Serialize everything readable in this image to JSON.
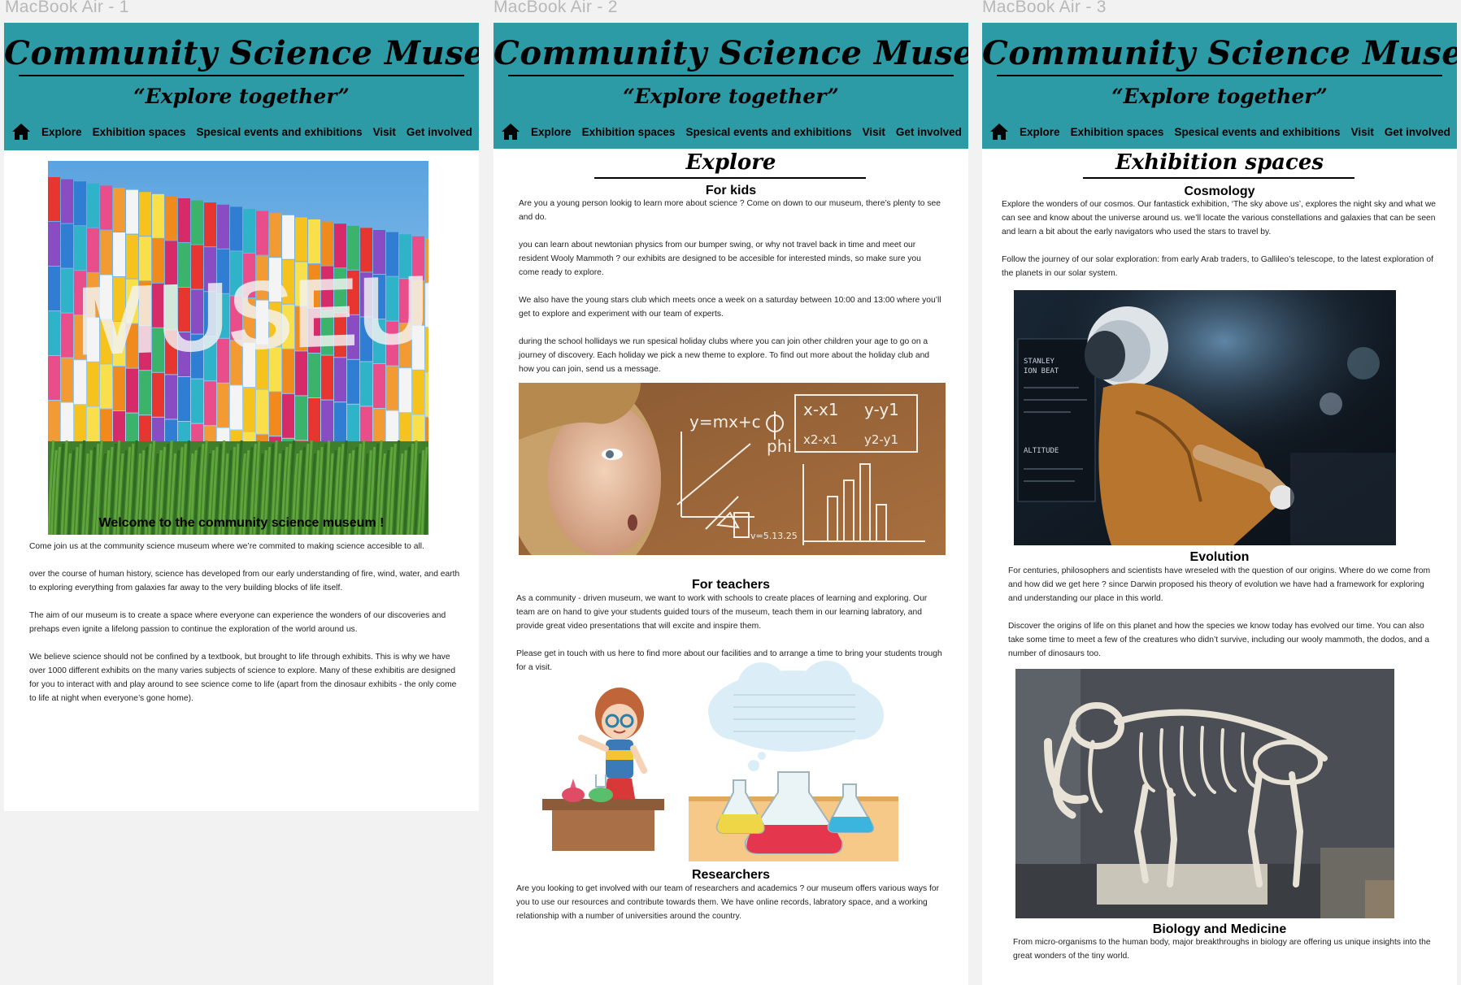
{
  "frames": [
    {
      "label": "MacBook Air - 1",
      "welcome_heading": "Welcome to the community science museum !",
      "paragraphs": [
        "Come join us at the community science museum where we’re commited to making science accesible to all.",
        "over the course of human history, science has developed from our early understanding of fire, wind, water, and earth to exploring everything from galaxies far away to the very building blocks of life itself.",
        "The aim of our museum is to create a space where everyone can experience the wonders of our discoveries and prehaps even ignite a lifelong passion to continue the exploration of the world around us.",
        "We believe science should not be confined by a textbook, but brought to life through exhibits. This is why we have over 1000 different exhibits on the many varies subjects of science to explore. Many of these exhibitis are designed for you to interact with and play around to see science come to life (apart from the dinosaur exhibits - the only come to life at night when everyone’s gone home)."
      ]
    },
    {
      "label": "MacBook Air - 2",
      "section_heading": "Explore",
      "kids_heading": "For kids",
      "kids_paragraphs": [
        "Are you a young person lookig to learn more about science ? Come on down to our museum, there’s plenty to see and do.",
        "you can learn about newtonian physics from our bumper swing, or why not travel back in time and meet our resident Wooly Mammoth ? our exhibits are designed to be accesible for interested minds, so make sure you come ready to explore.",
        "We also have the young stars club which meets once a week on a saturday between 10:00 and 13:00 where you’ll get to explore and experiment with our team of experts.",
        "during the school hollidays we run spesical holiday clubs where you can join other children your age to go on a journey of discovery. Each holiday we pick a new theme to explore. To find out more about the holiday club and how you can join, send us a message."
      ],
      "chalk_texts": [
        "y=mx+c",
        "phi",
        "x-x1",
        "y-y1",
        "x2-x1",
        "y2-y1",
        "v=5.13.25"
      ],
      "teachers_heading": "For teachers",
      "teachers_paragraphs": [
        "As a community - driven museum, we want to work with schools to create places of learning and exploring. Our team are on hand to give your students guided tours of the museum, teach them in our learning labratory, and provide great video presentations that will excite and inspire them.",
        "Please get in touch with us here to find more about our facilities and to arrange a time to bring your students trough for a visit."
      ],
      "researchers_heading": "Researchers",
      "researchers_paragraphs": [
        "Are you looking to get involved with our team of researchers and academics ? our museum offers various ways for you to use our resources and contribute towards them. We have online records, labratory space, and a working relationship with a number of universities around the country."
      ]
    },
    {
      "label": "MacBook Air - 3",
      "section_heading": "Exhibition spaces",
      "cosmology_heading": "Cosmology",
      "cosmology_paragraphs": [
        "Explore the wonders of our cosmos. Our fantastick exhibition, ‘The sky above us’, explores the night sky and what we can see and know about the universe around us. we’ll locate the various constellations and galaxies that can be seen and learn a bit about the early navigators who used the stars to travel by.",
        "Follow the journey of our solar exploration: from early Arab traders, to Gallileo’s telescope, to the latest exploration of the planets in our solar system."
      ],
      "screen_texts": [
        "STANLEY",
        "ION BEAT",
        "ALTITUDE"
      ],
      "evolution_heading": "Evolution",
      "evolution_paragraphs": [
        "For centuries, philosophers and scientists have wreseled with the question of our origins. Where do we come from and how did we get here ? since Darwin proposed his theory of evolution we have had a framework for exploring and understanding our place in this world.",
        "Discover the origins of life on this planet and how the species we know today has evolved our time. You can also take some time to meet a few of the creatures who didn’t survive, including our wooly mammoth, the dodos, and a number of dinosaurs too."
      ],
      "biology_heading": "Biology and Medicine",
      "biology_paragraphs": [
        "From micro-organisms to the human body, major breakthroughs in biology are offering us unique insights into the great wonders of the tiny world."
      ]
    }
  ],
  "header": {
    "title": "Community Science Museum",
    "tagline": "“Explore together”",
    "nav": [
      "Explore",
      "Exhibition spaces",
      "Spesical events and exhibitions",
      "Visit",
      "Get involved"
    ],
    "home_icon": "home-icon"
  },
  "museum_sign": "MUSEUM",
  "colors": {
    "header_bg": "#2c9ba6",
    "canvas_bg": "#f2f2f2",
    "frame_label": "#b8b8b8"
  }
}
